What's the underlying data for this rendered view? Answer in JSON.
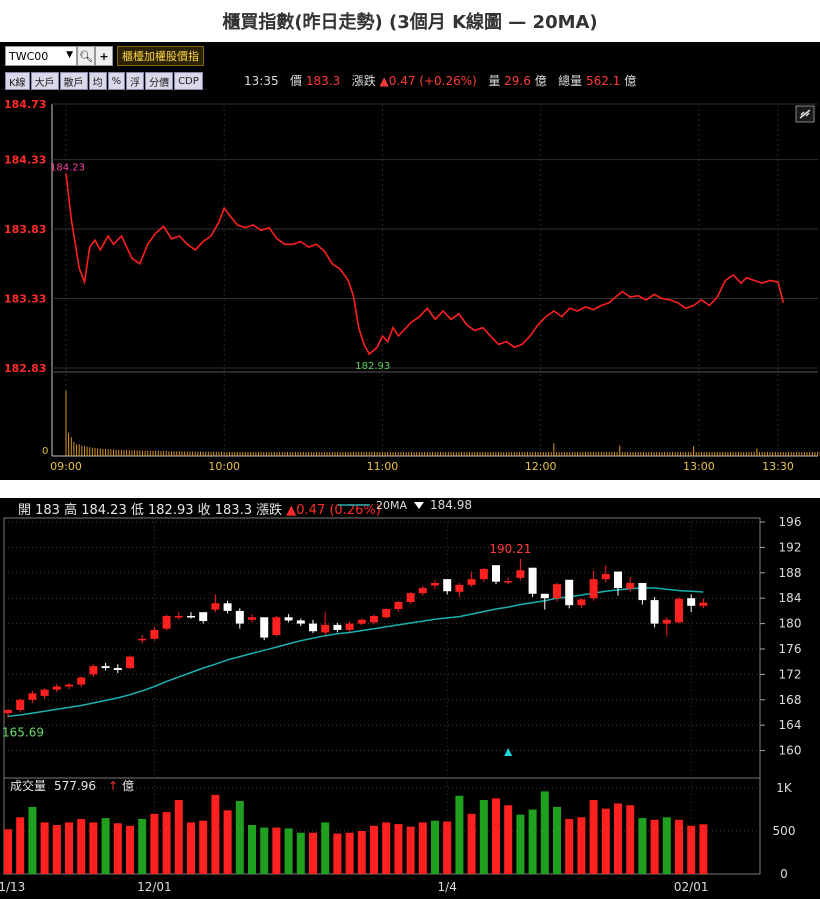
{
  "page": {
    "title": "櫃買指數(昨日走勢) (3個月 K線圖 — 20MA)"
  },
  "toolbar": {
    "symbol": "TWC00",
    "search_icon": "magnifier-icon",
    "plus_icon": "plus-icon",
    "index_button": "櫃檯加權股價指"
  },
  "tabs": [
    "K線",
    "大戶",
    "散戶",
    "均",
    "%",
    "浮",
    "分價",
    "CDP"
  ],
  "quote": {
    "time": "13:35",
    "price_label": "價",
    "price": "183.3",
    "change_label": "漲跌",
    "change": "▲0.47 (+0.26%)",
    "vol_label": "量",
    "vol": "29.6",
    "vol_unit": "億",
    "total_label": "總量",
    "total": "562.1",
    "total_unit": "億"
  },
  "intraday_chart": {
    "type": "line",
    "y_ticks": [
      "184.73",
      "184.33",
      "183.83",
      "183.33",
      "182.83"
    ],
    "y_tick_values": [
      184.73,
      184.33,
      183.83,
      183.33,
      182.83
    ],
    "ylim": [
      182.83,
      184.73
    ],
    "x_ticks": [
      "09:00",
      "10:00",
      "11:00",
      "12:00",
      "13:00",
      "13:30"
    ],
    "x_tick_minutes": [
      0,
      60,
      120,
      180,
      240,
      270
    ],
    "max_label": "184.23",
    "min_label": "182.93",
    "volume_zero_label": "0",
    "colors": {
      "line": "#ff2020",
      "volume": "#d9962a",
      "max": "#ff3fa0",
      "min": "#5bd35b"
    },
    "link_icon": "link-icon",
    "series": [
      [
        0,
        184.23
      ],
      [
        2,
        183.9
      ],
      [
        5,
        183.55
      ],
      [
        7,
        183.45
      ],
      [
        9,
        183.7
      ],
      [
        11,
        183.75
      ],
      [
        13,
        183.68
      ],
      [
        16,
        183.78
      ],
      [
        18,
        183.72
      ],
      [
        21,
        183.78
      ],
      [
        23,
        183.7
      ],
      [
        25,
        183.62
      ],
      [
        28,
        183.58
      ],
      [
        31,
        183.72
      ],
      [
        34,
        183.8
      ],
      [
        37,
        183.85
      ],
      [
        40,
        183.76
      ],
      [
        43,
        183.78
      ],
      [
        46,
        183.72
      ],
      [
        49,
        183.68
      ],
      [
        52,
        183.74
      ],
      [
        55,
        183.78
      ],
      [
        58,
        183.88
      ],
      [
        60,
        183.98
      ],
      [
        62,
        183.93
      ],
      [
        65,
        183.86
      ],
      [
        68,
        183.84
      ],
      [
        71,
        183.86
      ],
      [
        74,
        183.82
      ],
      [
        77,
        183.84
      ],
      [
        80,
        183.76
      ],
      [
        83,
        183.72
      ],
      [
        86,
        183.72
      ],
      [
        89,
        183.74
      ],
      [
        92,
        183.7
      ],
      [
        95,
        183.72
      ],
      [
        98,
        183.67
      ],
      [
        101,
        183.58
      ],
      [
        104,
        183.54
      ],
      [
        107,
        183.46
      ],
      [
        109,
        183.35
      ],
      [
        111,
        183.12
      ],
      [
        113,
        183.0
      ],
      [
        115,
        182.93
      ],
      [
        118,
        182.98
      ],
      [
        120,
        183.06
      ],
      [
        122,
        183.02
      ],
      [
        124,
        183.12
      ],
      [
        126,
        183.06
      ],
      [
        128,
        183.1
      ],
      [
        131,
        183.16
      ],
      [
        134,
        183.2
      ],
      [
        137,
        183.26
      ],
      [
        140,
        183.18
      ],
      [
        143,
        183.24
      ],
      [
        146,
        183.18
      ],
      [
        149,
        183.22
      ],
      [
        152,
        183.14
      ],
      [
        155,
        183.1
      ],
      [
        158,
        183.12
      ],
      [
        161,
        183.06
      ],
      [
        164,
        183.0
      ],
      [
        167,
        183.02
      ],
      [
        170,
        182.98
      ],
      [
        173,
        183.0
      ],
      [
        176,
        183.06
      ],
      [
        179,
        183.14
      ],
      [
        182,
        183.2
      ],
      [
        185,
        183.24
      ],
      [
        188,
        183.2
      ],
      [
        191,
        183.26
      ],
      [
        194,
        183.24
      ],
      [
        197,
        183.27
      ],
      [
        200,
        183.25
      ],
      [
        203,
        183.28
      ],
      [
        206,
        183.3
      ],
      [
        209,
        183.35
      ],
      [
        211,
        183.38
      ],
      [
        214,
        183.34
      ],
      [
        217,
        183.35
      ],
      [
        220,
        183.32
      ],
      [
        223,
        183.36
      ],
      [
        226,
        183.33
      ],
      [
        229,
        183.32
      ],
      [
        232,
        183.3
      ],
      [
        235,
        183.26
      ],
      [
        238,
        183.28
      ],
      [
        241,
        183.32
      ],
      [
        244,
        183.28
      ],
      [
        247,
        183.34
      ],
      [
        250,
        183.46
      ],
      [
        253,
        183.5
      ],
      [
        256,
        183.44
      ],
      [
        258,
        183.48
      ],
      [
        261,
        183.46
      ],
      [
        264,
        183.44
      ],
      [
        267,
        183.46
      ],
      [
        270,
        183.45
      ],
      [
        272,
        183.3
      ]
    ],
    "volume": [
      2.8,
      1.0,
      0.8,
      0.6,
      0.5,
      0.5,
      0.45,
      0.42,
      0.4,
      0.38,
      0.35,
      0.35,
      0.33,
      0.32,
      0.3,
      0.3,
      0.29,
      0.28,
      0.28,
      0.27,
      0.26,
      0.26,
      0.25,
      0.25,
      0.25,
      0.24,
      0.24,
      0.24,
      0.23,
      0.23,
      0.23,
      0.22,
      0.22,
      0.22,
      0.22,
      0.21,
      0.21,
      0.21,
      0.21,
      0.2,
      0.2,
      0.2,
      0.2,
      0.2,
      0.2,
      0.2,
      0.19,
      0.19,
      0.19,
      0.19,
      0.19,
      0.19,
      0.18,
      0.18,
      0.18,
      0.18,
      0.18,
      0.18,
      0.18,
      0.18,
      0.17,
      0.17,
      0.17,
      0.17,
      0.17,
      0.17,
      0.17,
      0.17,
      0.17,
      0.17,
      0.17,
      0.17,
      0.17,
      0.17,
      0.17,
      0.17,
      0.17,
      0.17,
      0.17,
      0.17,
      0.17,
      0.17,
      0.17,
      0.17,
      0.17,
      0.17,
      0.17,
      0.17,
      0.17,
      0.17,
      0.17,
      0.17,
      0.17,
      0.17,
      0.17,
      0.17,
      0.17,
      0.17,
      0.17,
      0.17,
      0.17,
      0.17,
      0.17,
      0.17,
      0.17,
      0.17,
      0.17,
      0.17,
      0.17,
      0.17,
      0.17,
      0.17,
      0.17,
      0.17,
      0.17,
      0.17,
      0.17,
      0.17,
      0.17,
      0.17,
      0.17,
      0.17,
      0.17,
      0.17,
      0.17,
      0.17,
      0.17,
      0.17,
      0.17,
      0.17,
      0.17,
      0.17,
      0.17,
      0.17,
      0.17,
      0.17,
      0.17,
      0.17,
      0.17,
      0.17,
      0.17,
      0.17,
      0.17,
      0.17,
      0.17,
      0.17,
      0.17,
      0.17,
      0.17,
      0.17,
      0.17,
      0.17,
      0.17,
      0.17,
      0.17,
      0.17,
      0.17,
      0.17,
      0.17,
      0.17,
      0.17,
      0.17,
      0.17,
      0.17,
      0.17,
      0.17,
      0.17,
      0.17,
      0.17,
      0.17,
      0.17,
      0.17,
      0.17,
      0.17,
      0.17,
      0.17,
      0.17,
      0.17,
      0.17,
      0.17,
      0.17,
      0.17,
      0.17,
      0.17,
      0.17,
      0.17,
      0.17,
      0.17,
      0.17,
      0.17,
      0.17,
      0.17,
      0.17,
      0.17,
      0.17,
      0.17,
      0.17,
      0.17,
      0.17,
      0.17,
      0.17,
      0.17,
      0.17,
      0.17,
      0.17,
      0.17,
      0.17,
      0.17,
      0.17,
      0.17,
      0.17,
      0.17,
      0.17,
      0.17,
      0.17,
      0.17,
      0.17,
      0.17,
      0.17,
      0.17,
      0.17,
      0.17,
      0.17,
      0.17,
      0.17,
      0.17,
      0.17,
      0.17,
      0.17,
      0.17,
      0.17,
      0.17,
      0.17,
      0.17,
      0.17,
      0.17,
      0.17,
      0.17,
      0.17,
      0.17,
      0.17,
      0.17,
      0.17,
      0.17,
      0.17,
      0.17,
      0.17,
      0.17,
      0.17,
      0.17,
      0.17,
      0.17,
      0.17,
      0.17,
      0.17,
      0.17,
      0.17,
      0.17,
      0.17,
      0.17,
      0.17,
      0.17,
      0.17,
      0.17,
      0.17,
      0.17,
      0.17,
      0.17,
      0.17,
      0.17,
      0.17,
      0.17,
      0.17,
      0.17,
      0.17,
      0.17,
      0.17,
      0.17,
      0.17,
      0.17,
      0.17,
      0.17,
      0.17,
      0.17,
      0.17,
      0.17,
      0.17,
      0.17,
      0.17,
      0.17,
      0.17,
      3.4
    ],
    "volume_spikes": [
      [
        185,
        0.55
      ],
      [
        210,
        0.45
      ],
      [
        238,
        0.42
      ],
      [
        262,
        0.32
      ]
    ]
  },
  "kline_chart": {
    "type": "candlestick",
    "info": {
      "open_label": "開",
      "open": "183",
      "high_label": "高",
      "high": "184.23",
      "low_label": "低",
      "low": "182.93",
      "close_label": "收",
      "close": "183.3",
      "change_label": "漲跌",
      "change": "▲0.47 (0.26%)"
    },
    "ma_legend": {
      "label": "20MA",
      "value": "184.98"
    },
    "y_ticks": [
      196,
      192,
      188,
      184,
      180,
      176,
      172,
      168,
      164,
      160
    ],
    "ylim": [
      156,
      196
    ],
    "x_ticks": [
      "11/13",
      "12/01",
      "1/4",
      "02/01"
    ],
    "x_tick_index": [
      0,
      12,
      36,
      56
    ],
    "annotations": {
      "high": "190.21",
      "low": "165.69"
    },
    "volume_title": "成交量",
    "volume_value": "577.96",
    "volume_unit": "億",
    "volume_ticks": [
      "1K",
      "500",
      "0"
    ],
    "volume_tick_values": [
      1000,
      500,
      0
    ],
    "volume_max": 1000,
    "colors": {
      "up": "#ff2020",
      "down": "#ffffff",
      "vol_up": "#ff2020",
      "vol_down": "#1fa01f",
      "ma": "#1ab0b0",
      "marker": "#22d5e0"
    },
    "marker_icon": "triangle-up-icon",
    "arrow_icon": "up-arrow-icon",
    "candles": [
      [
        165.9,
        166.6,
        165.2,
        166.4
      ],
      [
        166.4,
        168.2,
        166.0,
        168.0
      ],
      [
        168.0,
        169.4,
        167.5,
        169.0
      ],
      [
        168.6,
        169.8,
        168.2,
        169.6
      ],
      [
        169.6,
        170.5,
        169.2,
        170.1
      ],
      [
        170.1,
        170.6,
        169.7,
        170.4
      ],
      [
        170.4,
        171.7,
        170.0,
        171.5
      ],
      [
        172.0,
        173.6,
        171.6,
        173.3
      ],
      [
        173.3,
        173.8,
        172.6,
        173.0
      ],
      [
        173.0,
        173.6,
        172.2,
        172.7
      ],
      [
        173.0,
        175.0,
        172.8,
        174.8
      ],
      [
        177.4,
        178.2,
        176.9,
        177.6
      ],
      [
        177.6,
        179.4,
        177.3,
        179.0
      ],
      [
        179.2,
        181.4,
        178.9,
        181.2
      ],
      [
        181.0,
        181.8,
        180.6,
        181.2
      ],
      [
        181.2,
        181.8,
        180.8,
        181.0
      ],
      [
        181.8,
        181.5,
        180.0,
        180.4
      ],
      [
        182.2,
        184.6,
        181.8,
        183.2
      ],
      [
        183.2,
        183.6,
        181.6,
        182.0
      ],
      [
        182.0,
        182.4,
        179.2,
        180.0
      ],
      [
        180.6,
        181.5,
        180.2,
        181.0
      ],
      [
        181.0,
        180.9,
        177.4,
        177.8
      ],
      [
        178.2,
        181.2,
        178.0,
        181.0
      ],
      [
        181.0,
        181.5,
        180.2,
        180.5
      ],
      [
        180.5,
        180.8,
        179.6,
        180.0
      ],
      [
        180.0,
        180.6,
        178.5,
        178.8
      ],
      [
        178.6,
        181.8,
        178.2,
        179.8
      ],
      [
        179.8,
        180.1,
        178.6,
        179.0
      ],
      [
        179.0,
        180.4,
        178.7,
        180.0
      ],
      [
        180.0,
        180.8,
        179.8,
        180.6
      ],
      [
        180.2,
        181.4,
        179.9,
        181.2
      ],
      [
        181.0,
        182.4,
        180.8,
        182.3
      ],
      [
        182.3,
        183.6,
        181.9,
        183.4
      ],
      [
        183.4,
        185.0,
        183.1,
        184.8
      ],
      [
        184.8,
        185.9,
        184.4,
        185.6
      ],
      [
        186.0,
        186.9,
        185.4,
        186.4
      ],
      [
        187.0,
        186.8,
        184.6,
        185.1
      ],
      [
        185.0,
        186.4,
        184.2,
        186.1
      ],
      [
        186.1,
        188.2,
        185.8,
        187.0
      ],
      [
        187.0,
        188.8,
        186.6,
        188.6
      ],
      [
        189.2,
        188.5,
        186.2,
        186.6
      ],
      [
        186.6,
        187.2,
        186.2,
        186.7
      ],
      [
        187.2,
        190.21,
        186.8,
        188.4
      ],
      [
        188.8,
        188.5,
        184.2,
        184.7
      ],
      [
        184.7,
        184.2,
        182.2,
        184.0
      ],
      [
        184.0,
        186.4,
        183.5,
        186.2
      ],
      [
        186.9,
        185.5,
        182.4,
        182.9
      ],
      [
        182.9,
        184.0,
        182.5,
        183.8
      ],
      [
        184.0,
        188.3,
        183.6,
        187.0
      ],
      [
        187.0,
        189.2,
        186.5,
        187.8
      ],
      [
        188.2,
        187.4,
        184.4,
        185.6
      ],
      [
        185.5,
        187.3,
        185.0,
        186.4
      ],
      [
        186.4,
        185.8,
        183.0,
        183.7
      ],
      [
        183.7,
        184.2,
        179.4,
        180.0
      ],
      [
        180.0,
        181.0,
        178.0,
        180.6
      ],
      [
        180.2,
        184.2,
        180.0,
        183.9
      ],
      [
        184.0,
        184.6,
        181.8,
        182.8
      ],
      [
        182.8,
        184.0,
        182.4,
        183.3
      ]
    ],
    "ma20": [
      165.4,
      165.6,
      165.9,
      166.2,
      166.5,
      166.8,
      167.1,
      167.5,
      167.9,
      168.3,
      168.8,
      169.4,
      170.1,
      170.9,
      171.6,
      172.3,
      173.0,
      173.6,
      174.3,
      174.8,
      175.3,
      175.8,
      176.3,
      176.8,
      177.3,
      177.7,
      178.1,
      178.4,
      178.6,
      178.9,
      179.2,
      179.5,
      179.8,
      180.1,
      180.4,
      180.7,
      180.9,
      181.1,
      181.5,
      181.9,
      182.3,
      182.6,
      183.0,
      183.3,
      183.6,
      184.0,
      184.2,
      184.5,
      184.8,
      185.1,
      185.3,
      185.5,
      185.6,
      185.6,
      185.4,
      185.2,
      185.1,
      184.98
    ],
    "volumes": [
      [
        520,
        1
      ],
      [
        660,
        1
      ],
      [
        780,
        0
      ],
      [
        600,
        1
      ],
      [
        570,
        1
      ],
      [
        600,
        1
      ],
      [
        640,
        1
      ],
      [
        600,
        1
      ],
      [
        650,
        0
      ],
      [
        590,
        1
      ],
      [
        560,
        1
      ],
      [
        640,
        0
      ],
      [
        700,
        1
      ],
      [
        720,
        1
      ],
      [
        860,
        1
      ],
      [
        600,
        1
      ],
      [
        620,
        1
      ],
      [
        920,
        1
      ],
      [
        740,
        1
      ],
      [
        850,
        0
      ],
      [
        570,
        0
      ],
      [
        540,
        0
      ],
      [
        540,
        1
      ],
      [
        530,
        0
      ],
      [
        480,
        0
      ],
      [
        480,
        1
      ],
      [
        600,
        0
      ],
      [
        470,
        1
      ],
      [
        480,
        1
      ],
      [
        500,
        1
      ],
      [
        560,
        1
      ],
      [
        600,
        1
      ],
      [
        580,
        1
      ],
      [
        550,
        1
      ],
      [
        600,
        1
      ],
      [
        620,
        0
      ],
      [
        610,
        1
      ],
      [
        910,
        0
      ],
      [
        700,
        1
      ],
      [
        860,
        0
      ],
      [
        880,
        1
      ],
      [
        800,
        1
      ],
      [
        690,
        0
      ],
      [
        750,
        0
      ],
      [
        960,
        0
      ],
      [
        780,
        0
      ],
      [
        640,
        1
      ],
      [
        660,
        1
      ],
      [
        860,
        1
      ],
      [
        760,
        1
      ],
      [
        820,
        1
      ],
      [
        800,
        1
      ],
      [
        650,
        0
      ],
      [
        630,
        1
      ],
      [
        660,
        0
      ],
      [
        630,
        1
      ],
      [
        560,
        1
      ],
      [
        577.96,
        1
      ]
    ]
  }
}
